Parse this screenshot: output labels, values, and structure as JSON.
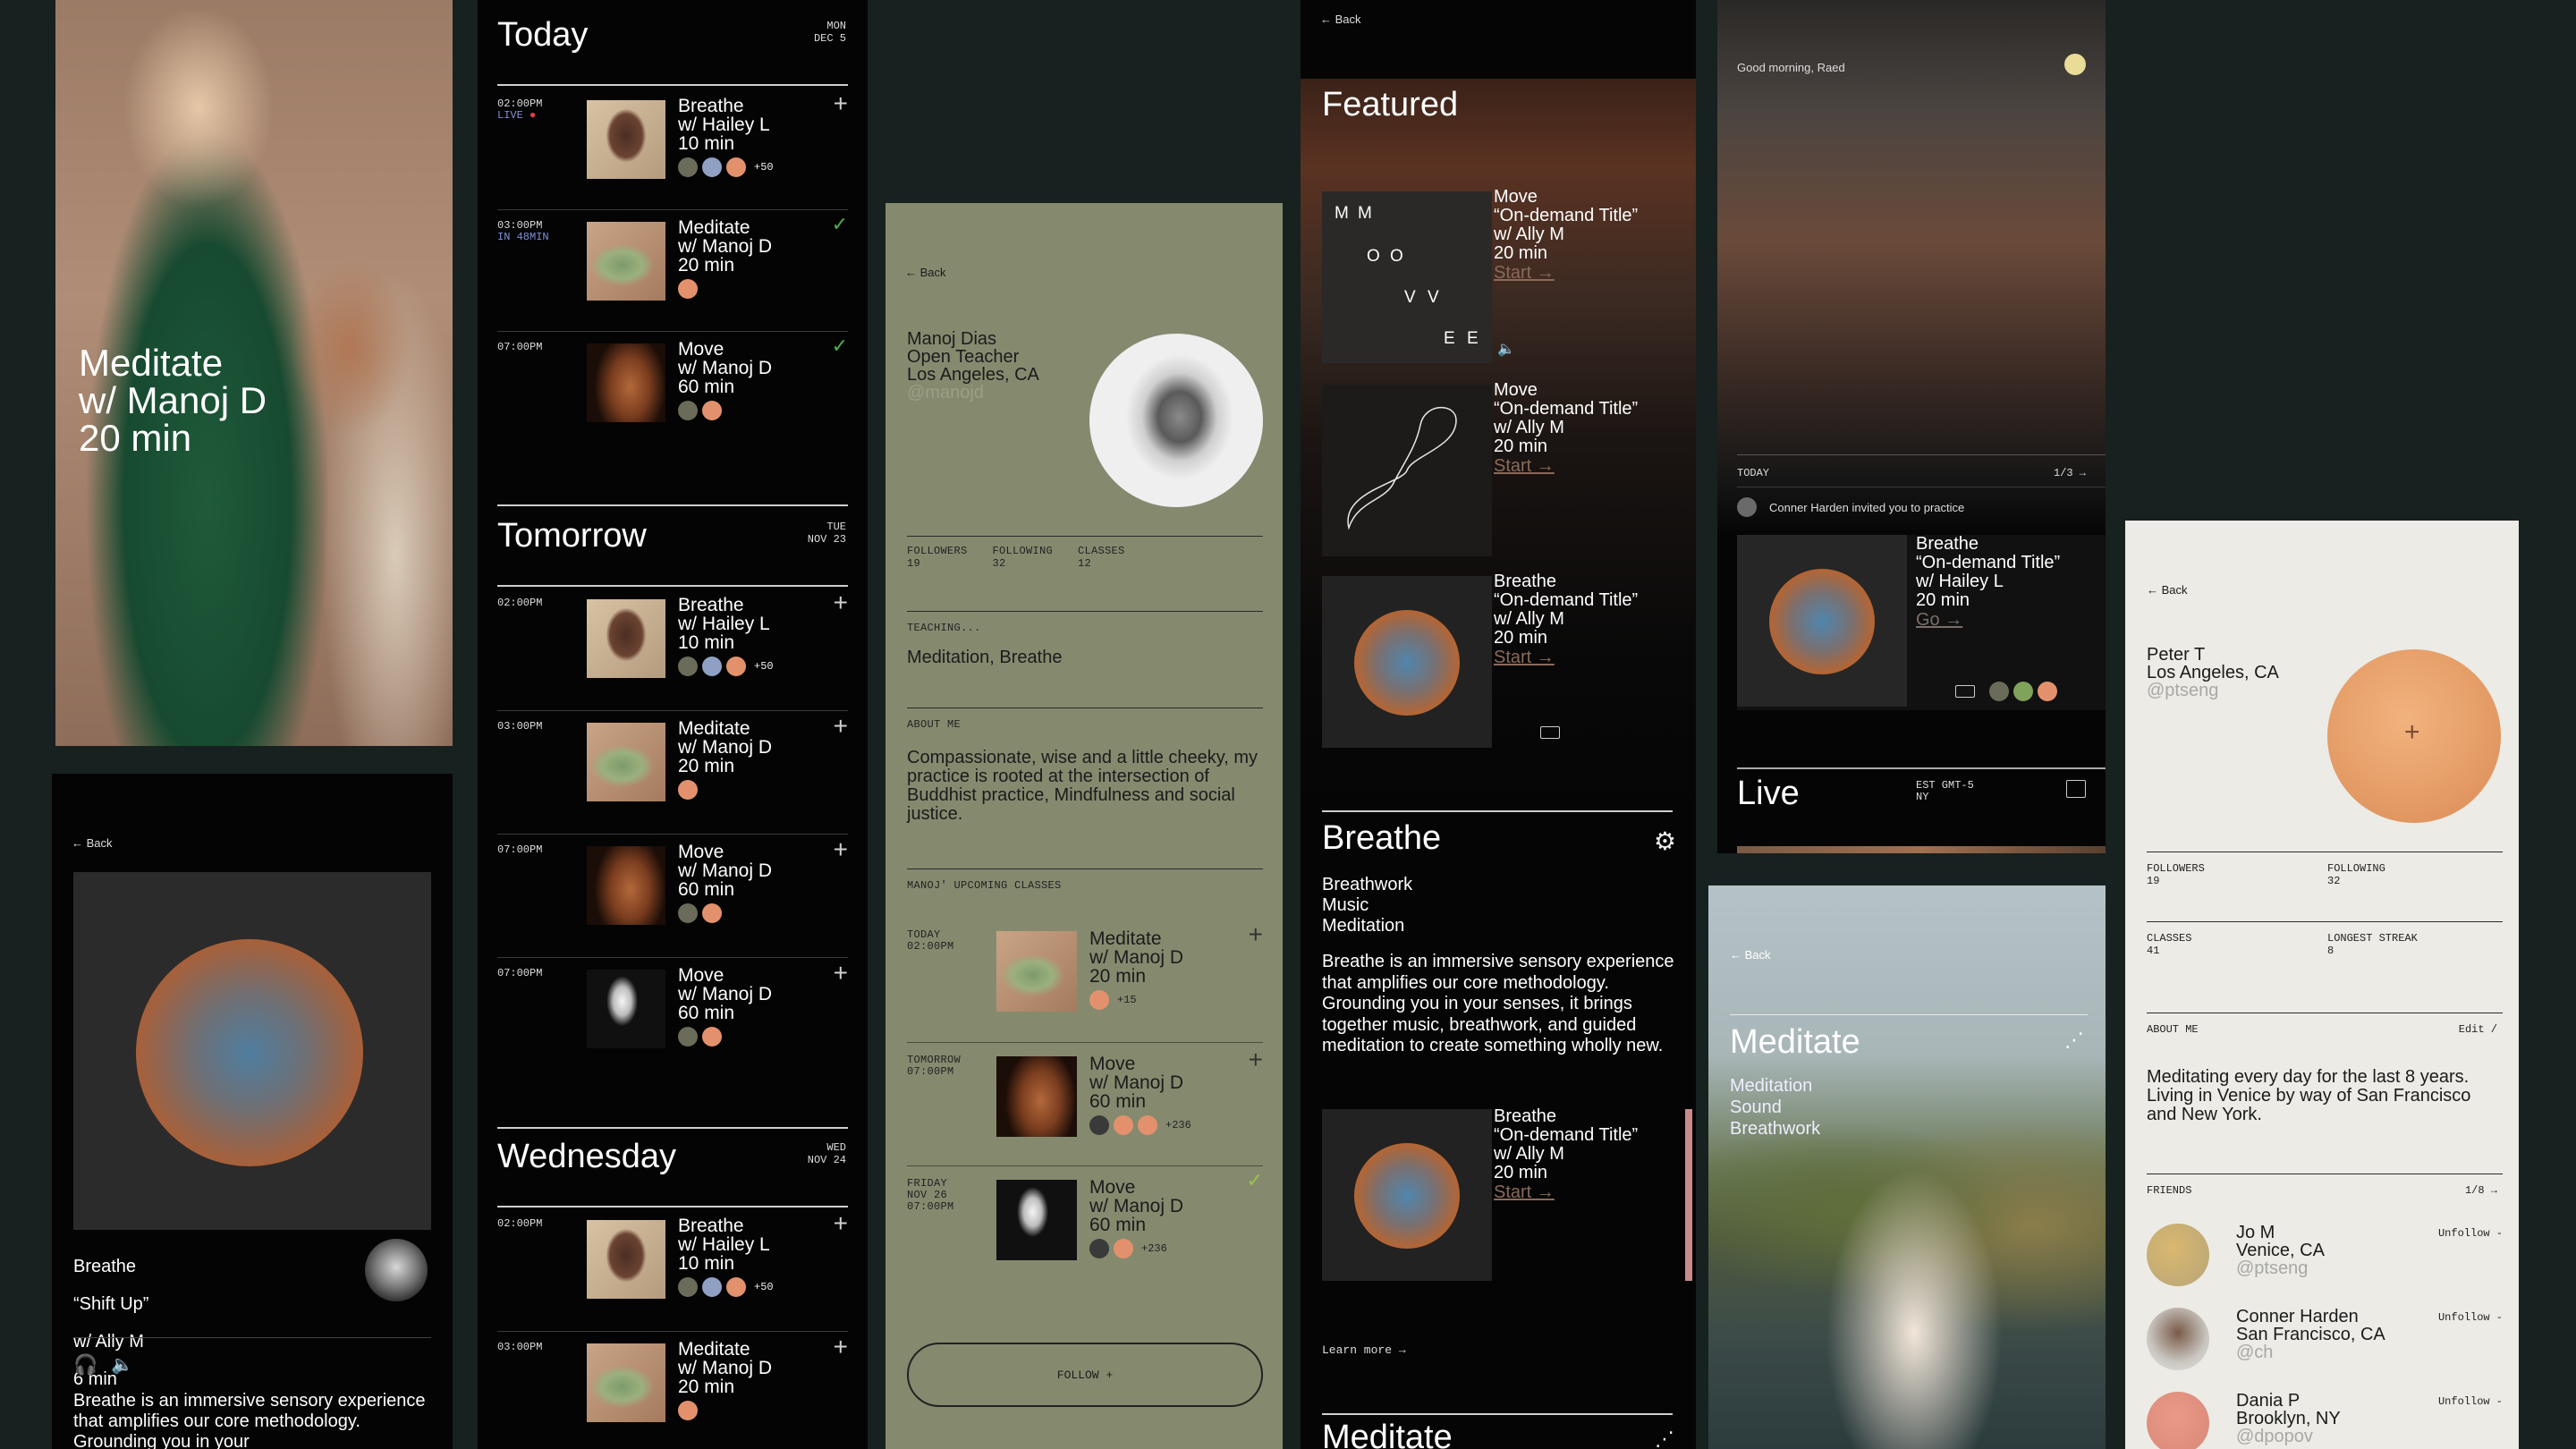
{
  "hero": {
    "title": "Meditate\nw/ Manoj D\n20 min"
  },
  "breathe_detail": {
    "back": "← Back",
    "title": "Breathe",
    "subtitle": "“Shift Up”",
    "teacher": "w/ Ally M",
    "duration": "6 min",
    "description": "Breathe is an immersive sensory experience that amplifies our core methodology. Grounding you in your"
  },
  "schedule": {
    "days": [
      {
        "name": "Today",
        "dow": "MON",
        "date": "DEC 5"
      },
      {
        "name": "Tomorrow",
        "dow": "TUE",
        "date": "NOV 23"
      },
      {
        "name": "Wednesday",
        "dow": "WED",
        "date": "NOV 24"
      }
    ],
    "today": [
      {
        "time": "02:00PM",
        "sub": "LIVE",
        "title": "Breathe\nw/ Hailey L\n10 min",
        "count": "+50",
        "action": "+"
      },
      {
        "time": "03:00PM",
        "sub": "IN 48MIN",
        "title": "Meditate\nw/ Manoj D\n20 min",
        "count": "",
        "action": "✓"
      },
      {
        "time": "07:00PM",
        "sub": "",
        "title": "Move\nw/ Manoj D\n60 min",
        "count": "",
        "action": "✓"
      }
    ],
    "tomorrow": [
      {
        "time": "02:00PM",
        "title": "Breathe\nw/ Hailey L\n10 min",
        "count": "+50"
      },
      {
        "time": "03:00PM",
        "title": "Meditate\nw/ Manoj D\n20 min",
        "count": ""
      },
      {
        "time": "07:00PM",
        "title": "Move\nw/ Manoj D\n60 min",
        "count": ""
      },
      {
        "time": "07:00PM",
        "title": "Move\nw/ Manoj D\n60 min",
        "count": ""
      }
    ],
    "wednesday": [
      {
        "time": "02:00PM",
        "title": "Breathe\nw/ Hailey L\n10 min",
        "count": "+50"
      },
      {
        "time": "03:00PM",
        "title": "Meditate\nw/ Manoj D\n20 min",
        "count": ""
      }
    ]
  },
  "manoj_profile": {
    "back": "← Back",
    "name": "Manoj Dias",
    "role": "Open Teacher",
    "location": "Los Angeles, CA",
    "handle": "@manojd",
    "stats": [
      {
        "label": "FOLLOWERS",
        "value": "19"
      },
      {
        "label": "FOLLOWING",
        "value": "32"
      },
      {
        "label": "CLASSES",
        "value": "12"
      }
    ],
    "teaching_label": "TEACHING...",
    "teaching": "Meditation, Breathe",
    "about_label": "ABOUT ME",
    "about": "Compassionate, wise and a little cheeky, my practice is rooted at the intersection of Buddhist practice, Mindfulness and social justice.",
    "upcoming_label": "MANOJ' UPCOMING CLASSES",
    "upcoming": [
      {
        "when": "TODAY\n02:00PM",
        "title": "Meditate\nw/ Manoj D\n20 min",
        "count": "+15",
        "action": "+"
      },
      {
        "when": "TOMORROW\n07:00PM",
        "title": "Move\nw/ Manoj D\n60 min",
        "count": "+236",
        "action": "+"
      },
      {
        "when": "FRIDAY\nNOV 26\n07:00PM",
        "title": "Move\nw/ Manoj D\n60 min",
        "count": "+236",
        "action": "✓"
      }
    ],
    "follow": "FOLLOW +"
  },
  "featured": {
    "back": "← Back",
    "title": "Featured",
    "mmove": [
      "M",
      "M",
      "O",
      "O",
      "V",
      "V",
      "E",
      "E"
    ],
    "items": [
      {
        "title": "Move\n“On-demand Title”\nw/ Ally M\n20 min",
        "link": "Start →"
      },
      {
        "title": "Move\n“On-demand Title”\nw/ Ally M\n20 min",
        "link": "Start →"
      },
      {
        "title": "Breathe\n“On-demand Title”\nw/ Ally M\n20 min",
        "link": "Start →"
      }
    ],
    "breathe_title": "Breathe",
    "breathe_tags": "Breathwork\nMusic\nMeditation",
    "breathe_desc": "Breathe is an immersive sensory experience that amplifies our core methodology. Grounding you in your senses, it brings together music, breathwork, and guided meditation to create something wholly new.",
    "item4": {
      "title": "Breathe\n“On-demand Title”\nw/ Ally M\n20 min",
      "link": "Start →"
    },
    "learn_more": "Learn more →",
    "next_title": "Meditate"
  },
  "live_panel": {
    "greeting": "Good morning, Raed",
    "today": "TODAY",
    "pager": "1/3 →",
    "invite": "Conner Harden invited you to practice",
    "card": {
      "title": "Breathe\n“On-demand Title”\nw/ Hailey L\n20 min",
      "link": "Go →"
    },
    "live_title": "Live",
    "tz": "EST GMT-5\nNY"
  },
  "meditate_photo": {
    "back": "← Back",
    "title": "Meditate",
    "tags": "Meditation\nSound\nBreathwork"
  },
  "peter": {
    "back": "← Back",
    "name": "Peter T",
    "location": "Los Angeles, CA",
    "handle": "@ptseng",
    "stats": [
      {
        "label": "FOLLOWERS",
        "value": "19"
      },
      {
        "label": "FOLLOWING",
        "value": "32"
      },
      {
        "label": "CLASSES",
        "value": "41"
      },
      {
        "label": "LONGEST STREAK",
        "value": "8"
      }
    ],
    "about_label": "ABOUT ME",
    "edit": "Edit /",
    "about": "Meditating every day for the last 8 years. Living in Venice by way of San Francisco and New York.",
    "friends_label": "FRIENDS",
    "friends_pager": "1/8 →",
    "friends": [
      {
        "name": "Jo M",
        "location": "Venice, CA",
        "handle": "@ptseng",
        "action": "Unfollow -"
      },
      {
        "name": "Conner Harden",
        "location": "San Francisco, CA",
        "handle": "@ch",
        "action": "Unfollow -"
      },
      {
        "name": "Dania P",
        "location": "Brooklyn, NY",
        "handle": "@dpopov",
        "action": "Unfollow -"
      }
    ]
  }
}
